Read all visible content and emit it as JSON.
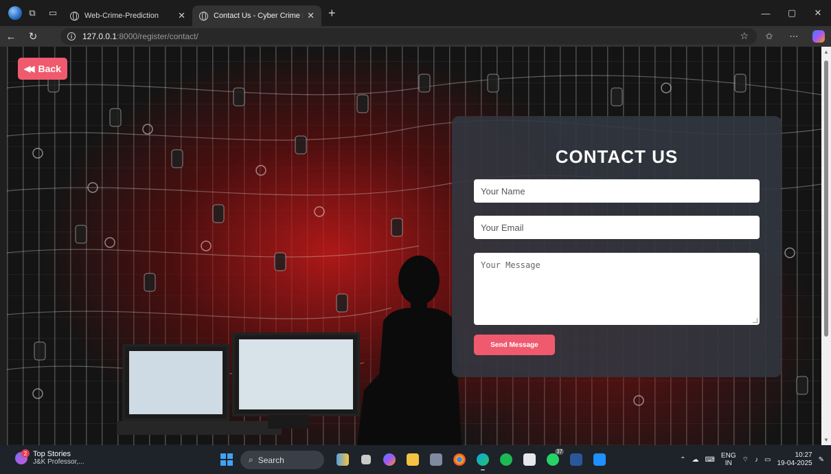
{
  "browser": {
    "tabs": [
      {
        "title": "Web-Crime-Prediction",
        "active": false
      },
      {
        "title": "Contact Us - Cyber Crime Predicti",
        "active": true
      }
    ],
    "new_tab": "+",
    "url_host": "127.0.0.1",
    "url_rest": ":8000/register/contact/",
    "window_controls": {
      "minimize": "—",
      "maximize": "▢",
      "close": "✕"
    }
  },
  "page": {
    "back_label": "Back",
    "heading": "CONTACT US",
    "name_placeholder": "Your Name",
    "email_placeholder": "Your Email",
    "message_placeholder": "Your Message",
    "send_label": "Send Message",
    "accent_color": "#f05a6e"
  },
  "taskbar": {
    "weather_title": "Top Stories",
    "weather_sub": "J&K Professor,...",
    "weather_badge": "2",
    "search_label": "Search",
    "whatsapp_count": "37",
    "lang_top": "ENG",
    "lang_bottom": "IN",
    "time": "10:27",
    "date": "19-04-2025"
  }
}
